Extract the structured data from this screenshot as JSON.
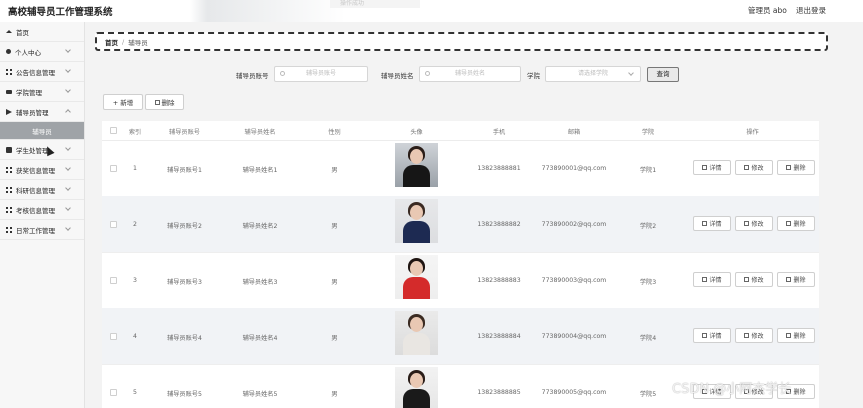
{
  "header": {
    "title": "高校辅导员工作管理系统",
    "user": "管理员 abo",
    "logout": "退出登录",
    "toast": "操作成功"
  },
  "sidebar": {
    "items": [
      {
        "label": "首页",
        "icon": "home-icon"
      },
      {
        "label": "个人中心",
        "icon": "user-icon"
      },
      {
        "label": "公告信息管理",
        "icon": "grid-icon"
      },
      {
        "label": "学院管理",
        "icon": "cap-icon"
      },
      {
        "label": "辅导员管理",
        "icon": "send-icon"
      },
      {
        "label": "辅导员",
        "icon": ""
      },
      {
        "label": "学生处管理",
        "icon": "book-icon"
      },
      {
        "label": "获奖信息管理",
        "icon": "grid-icon"
      },
      {
        "label": "科研信息管理",
        "icon": "grid-icon"
      },
      {
        "label": "考核信息管理",
        "icon": "grid-icon"
      },
      {
        "label": "日常工作管理",
        "icon": "grid-icon"
      }
    ]
  },
  "breadcrumb": {
    "home": "首页",
    "sep": "/",
    "current": "辅导员"
  },
  "search": {
    "account_label": "辅导员账号",
    "account_placeholder": "辅导员账号",
    "name_label": "辅导员姓名",
    "name_placeholder": "辅导员姓名",
    "college_label": "学院",
    "college_placeholder": "请选择学院",
    "button": "查询"
  },
  "actions": {
    "add": "+ 新增",
    "delete": "删除"
  },
  "table": {
    "headers": [
      "索引",
      "辅导员账号",
      "辅导员姓名",
      "性别",
      "头像",
      "手机",
      "邮箱",
      "学院",
      "操作"
    ],
    "rows": [
      {
        "index": "1",
        "account": "辅导员账号1",
        "name": "辅导员姓名1",
        "gender": "男",
        "phone": "13823888881",
        "email": "773890001@qq.com",
        "college": "学院1"
      },
      {
        "index": "2",
        "account": "辅导员账号2",
        "name": "辅导员姓名2",
        "gender": "男",
        "phone": "13823888882",
        "email": "773890002@qq.com",
        "college": "学院2"
      },
      {
        "index": "3",
        "account": "辅导员账号3",
        "name": "辅导员姓名3",
        "gender": "男",
        "phone": "13823888883",
        "email": "773890003@qq.com",
        "college": "学院3"
      },
      {
        "index": "4",
        "account": "辅导员账号4",
        "name": "辅导员姓名4",
        "gender": "男",
        "phone": "13823888884",
        "email": "773890004@qq.com",
        "college": "学院4"
      },
      {
        "index": "5",
        "account": "辅导员账号5",
        "name": "辅导员姓名5",
        "gender": "男",
        "phone": "13823888885",
        "email": "773890005@qq.com",
        "college": "学院5"
      }
    ],
    "op_labels": {
      "detail": "详情",
      "edit": "修改",
      "delete": "删除"
    }
  },
  "watermark": "CSDN @小阿杰学长"
}
